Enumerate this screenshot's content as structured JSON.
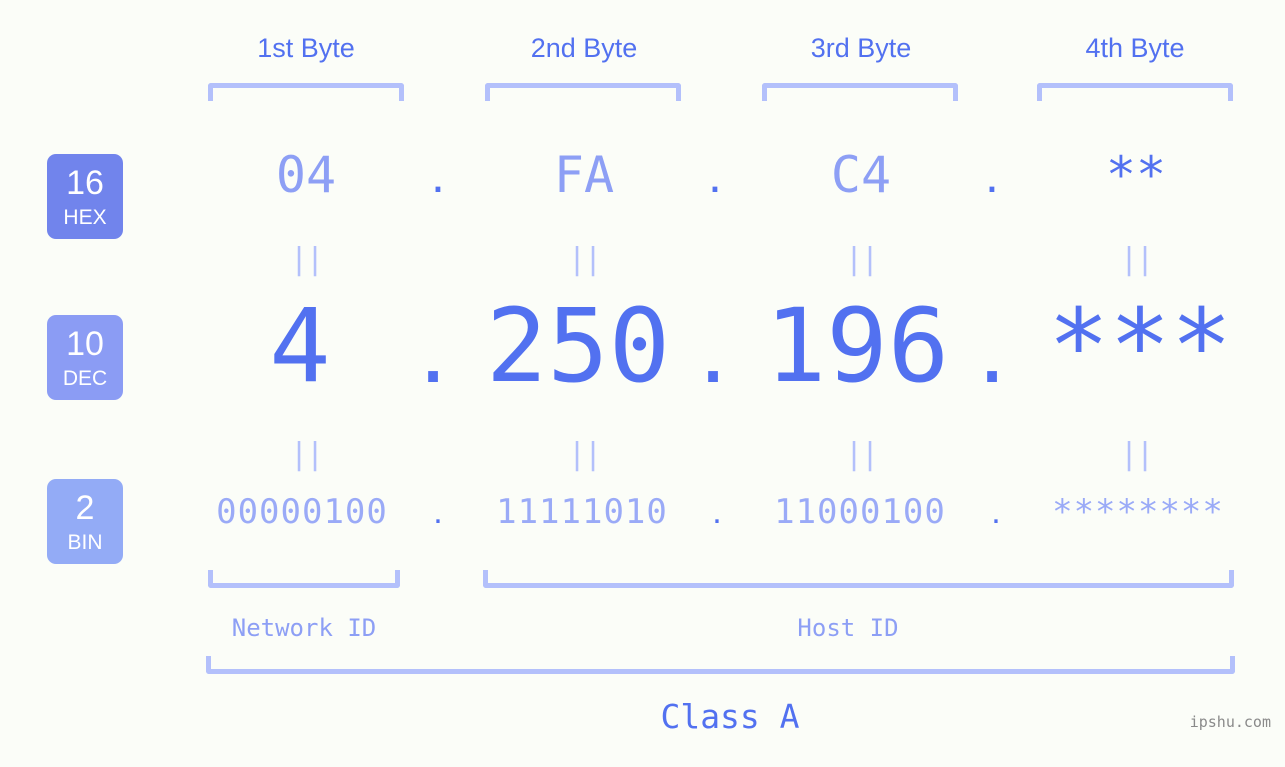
{
  "meta": {
    "background_color": "#fbfdf8",
    "accent_strong": "#5271f0",
    "accent_mid": "#8d9ff5",
    "accent_light": "#b3c0fb",
    "watermark": "ipshu.com"
  },
  "byte_headers": [
    {
      "label": "1st Byte"
    },
    {
      "label": "2nd Byte"
    },
    {
      "label": "3rd Byte"
    },
    {
      "label": "4th Byte"
    }
  ],
  "radix_badges": [
    {
      "base": "16",
      "name": "HEX",
      "color": "#7184ec"
    },
    {
      "base": "10",
      "name": "DEC",
      "color": "#8b9cf4"
    },
    {
      "base": "2",
      "name": "BIN",
      "color": "#93abf6"
    }
  ],
  "rows": {
    "hex": {
      "base": "16",
      "label": "HEX",
      "octets": [
        "04",
        "FA",
        "C4",
        "**"
      ],
      "separator": "."
    },
    "dec": {
      "base": "10",
      "label": "DEC",
      "octets": [
        "4",
        "250",
        "196",
        "***"
      ],
      "separator": "."
    },
    "bin": {
      "base": "2",
      "label": "BIN",
      "octets": [
        "00000100",
        "11111010",
        "11000100",
        "********"
      ],
      "separator": "."
    }
  },
  "equals_marks": [
    "||",
    "||",
    "||",
    "||",
    "||",
    "||",
    "||",
    "||"
  ],
  "footer": {
    "network_id_label": "Network ID",
    "host_id_label": "Host ID",
    "class_label": "Class A"
  }
}
